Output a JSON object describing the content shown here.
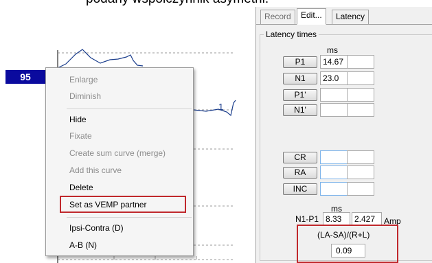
{
  "caption": "podany współczynnik asymetrii.",
  "graph": {
    "curve_label": "95",
    "marker_label": "1"
  },
  "context_menu": {
    "items": [
      {
        "label": "Enlarge",
        "enabled": false
      },
      {
        "label": "Diminish",
        "enabled": false
      },
      {
        "label": "Hide",
        "enabled": true
      },
      {
        "label": "Fixate",
        "enabled": false
      },
      {
        "label": "Create sum curve (merge)",
        "enabled": false
      },
      {
        "label": "Add this curve",
        "enabled": false
      },
      {
        "label": "Delete",
        "enabled": true
      },
      {
        "label": "Set as VEMP partner",
        "enabled": true,
        "highlighted": true
      },
      {
        "label": "Ipsi-Contra (D)",
        "enabled": true
      },
      {
        "label": "A-B (N)",
        "enabled": true
      }
    ],
    "highlight_color": "#c0282c"
  },
  "panel": {
    "tabs": [
      {
        "label": "Record",
        "active": false
      },
      {
        "label": "Edit...",
        "active": true
      },
      {
        "label": "Latency",
        "active": false
      }
    ],
    "group_title": "Latency times",
    "ms_header": "ms",
    "latency_rows": [
      {
        "button": "P1",
        "value": "14.67",
        "extra": ""
      },
      {
        "button": "N1",
        "value": "23.0",
        "extra": ""
      },
      {
        "button": "P1'",
        "value": "",
        "extra": ""
      },
      {
        "button": "N1'",
        "value": "",
        "extra": ""
      }
    ],
    "ratio_rows": [
      {
        "button": "CR",
        "value": "",
        "extra": ""
      },
      {
        "button": "RA",
        "value": "",
        "extra": ""
      },
      {
        "button": "INC",
        "value": "",
        "extra": ""
      }
    ],
    "amp_ms_header": "ms",
    "n1p1": {
      "label": "N1-P1",
      "ms": "8.33",
      "amp": "2.427",
      "amp_label": "Amp"
    },
    "asymmetry": {
      "formula": "(LA-SA)/(R+L)",
      "value": "0.09"
    }
  }
}
